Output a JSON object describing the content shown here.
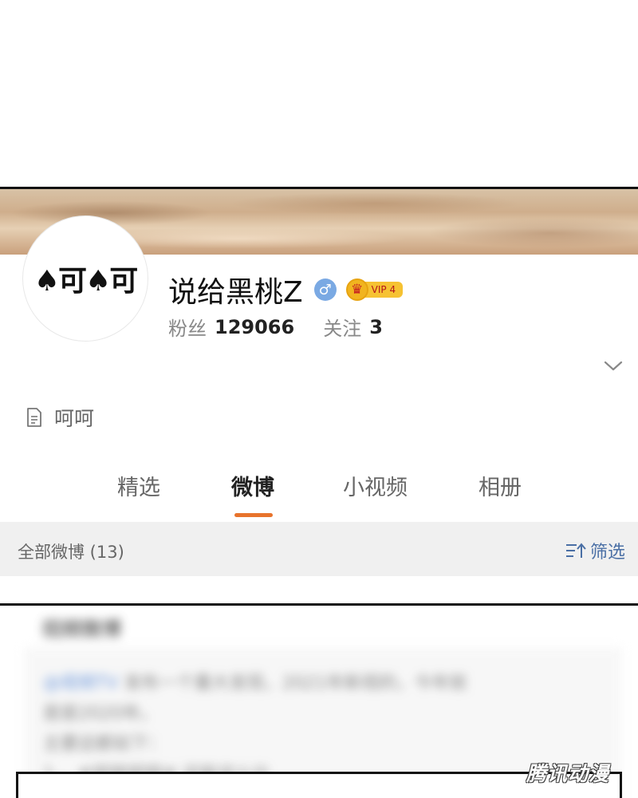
{
  "profile": {
    "avatar_text": "♠可♠可",
    "username": "说给黑桃Z",
    "gender_symbol": "♂",
    "vip_label": "VIP 4",
    "followers_label": "粉丝",
    "followers_value": "129066",
    "following_label": "关注",
    "following_value": "3",
    "bio": "呵呵"
  },
  "tabs": [
    {
      "label": "精选",
      "active": false
    },
    {
      "label": "微博",
      "active": true
    },
    {
      "label": "小视频",
      "active": false
    },
    {
      "label": "相册",
      "active": false
    }
  ],
  "filter_bar": {
    "count_label": "全部微博 (13)",
    "filter_label": "筛选"
  },
  "blurred_post": {
    "section_title": "视频微博",
    "link_text": "@视频TV",
    "line1": "发布一个重大发现，2021年新视的，今年就",
    "line2": "是是2020年。",
    "line3": "主要这都如下：",
    "line4": "1、 #视频视频# 还能这么比"
  },
  "watermark": "腾讯动漫",
  "colors": {
    "accent_underline": "#e8732c",
    "filter_blue": "#4a6fa5",
    "gender_blue": "#7aa9e3",
    "vip_gold": "#f6c232"
  }
}
